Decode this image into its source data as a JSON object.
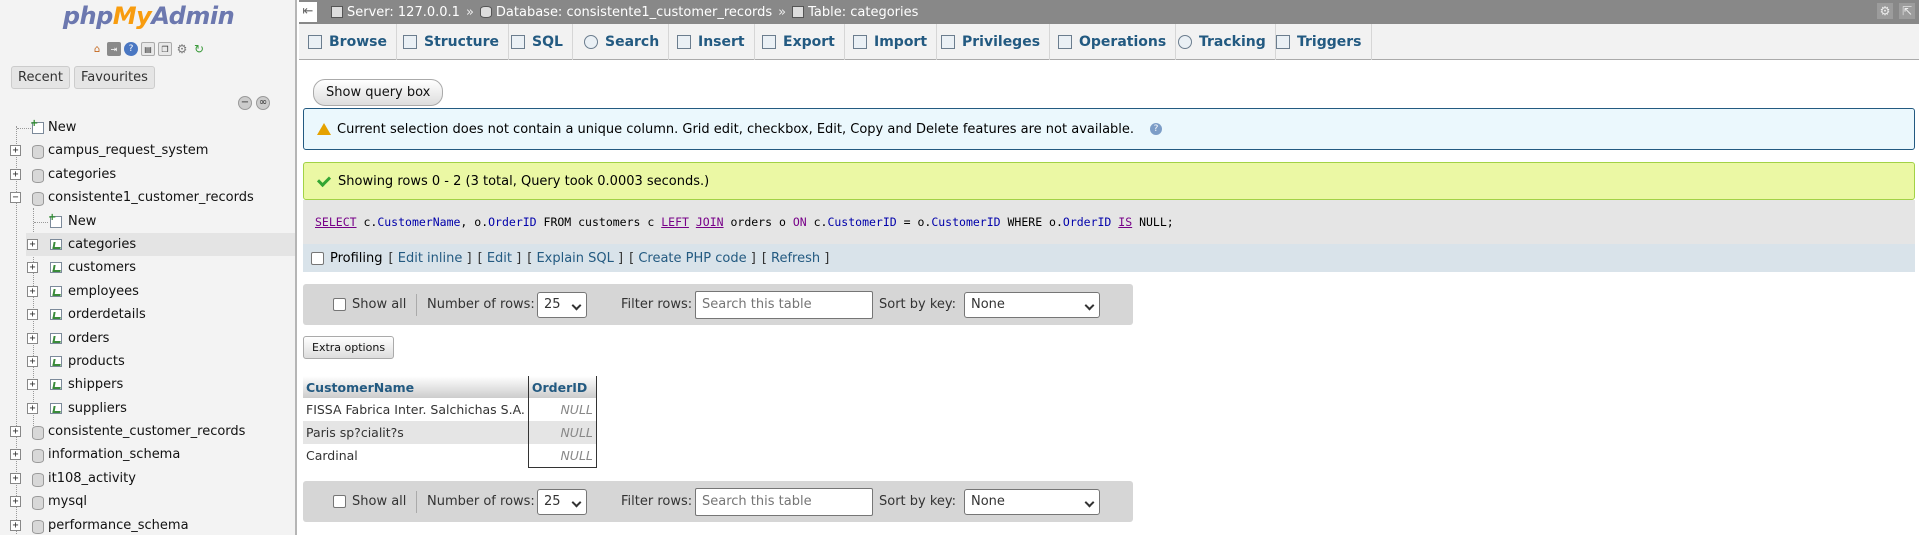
{
  "app": {
    "logo_php": "php",
    "logo_my": "My",
    "logo_admin": "Admin"
  },
  "left_tabs": [
    "Recent",
    "Favourites"
  ],
  "tree": [
    {
      "label": "New",
      "type": "new",
      "level": 0
    },
    {
      "label": "campus_request_system",
      "type": "db",
      "level": 0
    },
    {
      "label": "categories",
      "type": "db",
      "level": 0
    },
    {
      "label": "consistente1_customer_records",
      "type": "db-open",
      "level": 0
    },
    {
      "label": "New",
      "type": "new",
      "level": 1
    },
    {
      "label": "categories",
      "type": "table",
      "level": 1,
      "selected": true
    },
    {
      "label": "customers",
      "type": "table",
      "level": 1
    },
    {
      "label": "employees",
      "type": "table",
      "level": 1
    },
    {
      "label": "orderdetails",
      "type": "table",
      "level": 1
    },
    {
      "label": "orders",
      "type": "table",
      "level": 1
    },
    {
      "label": "products",
      "type": "table",
      "level": 1
    },
    {
      "label": "shippers",
      "type": "table",
      "level": 1
    },
    {
      "label": "suppliers",
      "type": "table",
      "level": 1
    },
    {
      "label": "consistente_customer_records",
      "type": "db",
      "level": 0
    },
    {
      "label": "information_schema",
      "type": "db",
      "level": 0
    },
    {
      "label": "it108_activity",
      "type": "db",
      "level": 0
    },
    {
      "label": "mysql",
      "type": "db",
      "level": 0
    },
    {
      "label": "performance_schema",
      "type": "db",
      "level": 0
    }
  ],
  "breadcrumb": {
    "server": "Server: 127.0.0.1",
    "database": "Database: consistente1_customer_records",
    "table": "Table: categories",
    "sep": "»"
  },
  "menu_tabs": [
    "Browse",
    "Structure",
    "SQL",
    "Search",
    "Insert",
    "Export",
    "Import",
    "Privileges",
    "Operations",
    "Tracking",
    "Triggers"
  ],
  "show_query_box": "Show query box",
  "notice_text": "Current selection does not contain a unique column. Grid edit, checkbox, Edit, Copy and Delete features are not available.",
  "success_text": "Showing rows 0 - 2 (3 total, Query took 0.0003 seconds.)",
  "sql": {
    "select": "SELECT",
    "p1": " c.",
    "f1": "CustomerName",
    "p2": ", o.",
    "f2": "OrderID",
    "p3": " FROM customers c ",
    "left": "LEFT",
    "p4": " ",
    "join": "JOIN",
    "p5": " orders o ",
    "on": "ON",
    "p6": " c.",
    "f3": "CustomerID",
    "p7": " = o.",
    "f4": "CustomerID",
    "p8": " WHERE o.",
    "f5": "OrderID",
    "p9": " ",
    "is": "IS",
    "p10": " NULL;"
  },
  "profiling": {
    "label": "Profiling",
    "links": [
      "Edit inline",
      "Edit",
      "Explain SQL",
      "Create PHP code",
      "Refresh"
    ]
  },
  "nav": {
    "show_all": "Show all",
    "num_rows_label": "Number of rows:",
    "num_rows_value": "25",
    "filter_label": "Filter rows:",
    "filter_placeholder": "Search this table",
    "sort_label": "Sort by key:",
    "sort_value": "None"
  },
  "extra_options": "Extra options",
  "table": {
    "headers": [
      "CustomerName",
      "OrderID"
    ],
    "rows": [
      [
        "FISSA Fabrica Inter. Salchichas S.A.",
        "NULL"
      ],
      [
        "Paris sp?cialit?s",
        "NULL"
      ],
      [
        "Cardinal",
        "NULL"
      ]
    ]
  }
}
